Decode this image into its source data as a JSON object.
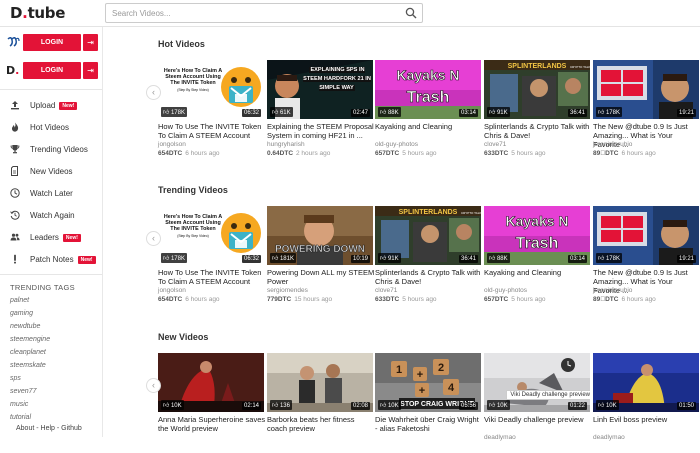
{
  "header": {
    "logo_main": "D",
    "logo_rest": "tube",
    "search_placeholder": "Search Videos..."
  },
  "sidebar": {
    "logins": [
      {
        "platform": "steem",
        "label": "LOGIN"
      },
      {
        "platform": "dtube",
        "label": "LOGIN"
      }
    ],
    "nav": [
      {
        "icon": "upload-icon",
        "label": "Upload",
        "badge": "New!"
      },
      {
        "icon": "flame-icon",
        "label": "Hot Videos",
        "badge": ""
      },
      {
        "icon": "trophy-icon",
        "label": "Trending Videos",
        "badge": ""
      },
      {
        "icon": "new-icon",
        "label": "New Videos",
        "badge": ""
      },
      {
        "icon": "clock-icon",
        "label": "Watch Later",
        "badge": ""
      },
      {
        "icon": "history-icon",
        "label": "Watch Again",
        "badge": ""
      },
      {
        "icon": "users-icon",
        "label": "Leaders",
        "badge": "New!"
      },
      {
        "icon": "exclamation-icon",
        "label": "Patch Notes",
        "badge": "New!"
      }
    ],
    "trending_title": "TRENDING TAGS",
    "tags": [
      "palnet",
      "gaming",
      "newdtube",
      "steemengine",
      "cleanplanet",
      "steemskate",
      "sps",
      "seven77",
      "music",
      "tutorial"
    ],
    "footer": "About - Help - Github"
  },
  "sections": [
    {
      "title": "Hot Videos",
      "videos": [
        {
          "title": "How To Use The INVITE Token To Claim A STEEM Account",
          "author": "jongolson",
          "value": "654DTC",
          "time": "6 hours ago",
          "likes": "178K",
          "duration": "06:32",
          "thumb": "invite"
        },
        {
          "title": "Explaining the STEEM Proposal System in coming HF21 in ...",
          "author": "hungryharish",
          "value": "0.64DTC",
          "time": "2 hours ago",
          "likes": "61K",
          "duration": "02:47",
          "thumb": "sps"
        },
        {
          "title": "Kayaking and Cleaning",
          "author": "old-guy-photos",
          "value": "657DTC",
          "time": "5 hours ago",
          "likes": "88K",
          "duration": "03:14",
          "thumb": "kayak"
        },
        {
          "title": "Splinterlands & Crypto Talk with Chris & Dave!",
          "author": "clove71",
          "value": "633DTC",
          "time": "5 hours ago",
          "likes": "91K",
          "duration": "36:41",
          "thumb": "splinter"
        },
        {
          "title": "The New @dtube 0.9 Is Just Amazing... What is Your Favorite ...",
          "author": "jeronimorubio",
          "value": "89\u0000DTC",
          "time": "6 hours ago",
          "likes": "178K",
          "duration": "19:21",
          "thumb": "dtube09"
        }
      ]
    },
    {
      "title": "Trending Videos",
      "videos": [
        {
          "title": "How To Use The INVITE Token To Claim A STEEM Account",
          "author": "jongolson",
          "value": "654DTC",
          "time": "6 hours ago",
          "likes": "178K",
          "duration": "06:32",
          "thumb": "invite"
        },
        {
          "title": "Powering Down ALL my STEEM Power",
          "author": "sergiomendes",
          "value": "779DTC",
          "time": "15 hours ago",
          "likes": "181K",
          "duration": "10:19",
          "thumb": "powerdown"
        },
        {
          "title": "Splinterlands & Crypto Talk with Chris & Dave!",
          "author": "clove71",
          "value": "633DTC",
          "time": "5 hours ago",
          "likes": "91K",
          "duration": "36:41",
          "thumb": "splinter"
        },
        {
          "title": "Kayaking and Cleaning",
          "author": "old-guy-photos",
          "value": "657DTC",
          "time": "5 hours ago",
          "likes": "88K",
          "duration": "03:14",
          "thumb": "kayak"
        },
        {
          "title": "The New @dtube 0.9 Is Just Amazing... What is Your Favorite ...",
          "author": "jeronimorubio",
          "value": "89\u0000DTC",
          "time": "6 hours ago",
          "likes": "178K",
          "duration": "19:21",
          "thumb": "dtube09"
        }
      ]
    },
    {
      "title": "New Videos",
      "videos": [
        {
          "title": "Anna Maria Superheroine saves the World preview",
          "author": "",
          "value": "",
          "time": "",
          "likes": "10K",
          "duration": "02:14",
          "thumb": "anna"
        },
        {
          "title": "Barborka beats her fitness coach preview",
          "author": "",
          "value": "",
          "time": "",
          "likes": "136",
          "duration": "02:08",
          "thumb": "barborka"
        },
        {
          "title": "Die Wahrheit über Craig Wright - alias Faketoshi",
          "author": "",
          "value": "",
          "time": "",
          "likes": "10K",
          "duration": "05:56",
          "thumb": "craig"
        },
        {
          "title": "Viki Deadly challenge preview",
          "author": "deadlymao",
          "value": "",
          "time": "",
          "likes": "10K",
          "duration": "01:22",
          "thumb": "viki",
          "tooltip": "Viki Deadly challenge preview"
        },
        {
          "title": "Linh Evil boss preview",
          "author": "deadlymao",
          "value": "",
          "time": "",
          "likes": "10K",
          "duration": "01:50",
          "thumb": "linh"
        }
      ]
    }
  ],
  "thumb_text": {
    "invite": "Here's How To Claim A Steem Account Using The INVITE Token",
    "invite_sub": "(Step By Step Video)",
    "sps": "EXPLAINING SPS IN STEEM HARDFORK 21 IN SIMPLE WAY",
    "kayak": "Kayaks N Trash",
    "splinter": "SPLINTERLANDS",
    "splinter_sub": "CRYPTO TALK WITH CHRIS & DAVE",
    "powerdown": "POWERING DOWN",
    "craig": "STOP CRAIG WRIGHT",
    "craig_nums": "1 + 2 + 4"
  },
  "colors": {
    "accent": "#e31337",
    "kayak_bg": "#e63fd4"
  }
}
